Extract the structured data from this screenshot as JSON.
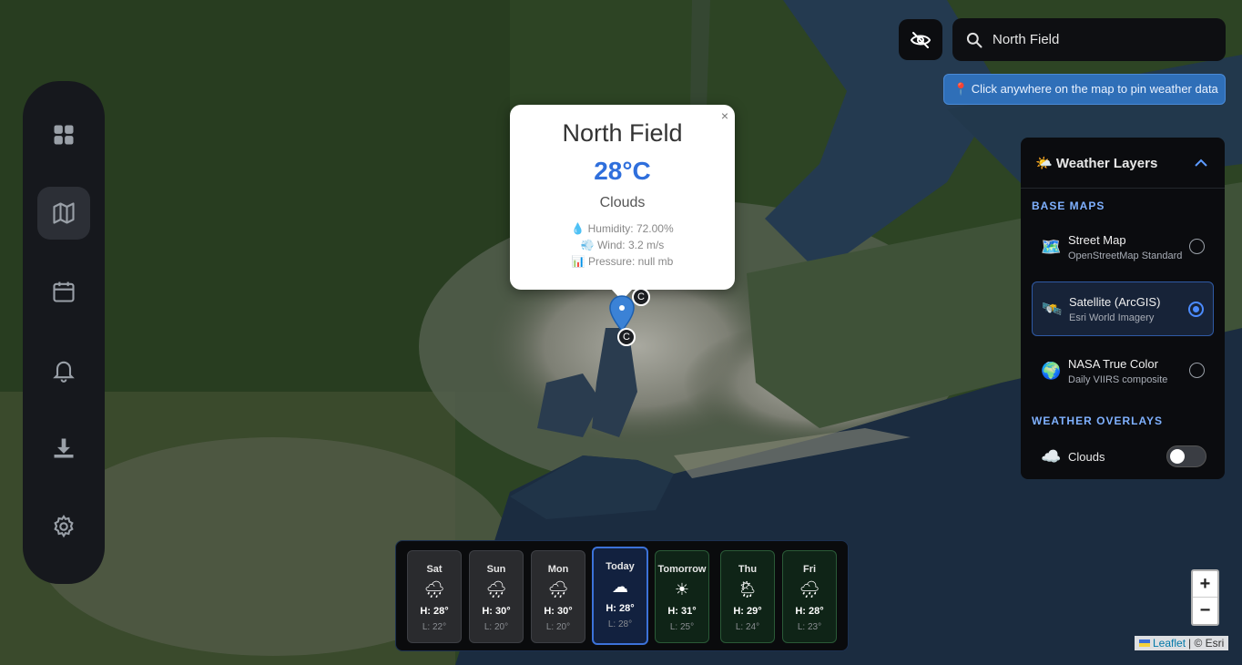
{
  "search": {
    "value": "North Field"
  },
  "hint": {
    "text": "📍 Click anywhere on the map to pin weather data"
  },
  "popup": {
    "close": "×",
    "city": "North Field",
    "temp": "28°C",
    "condition": "Clouds",
    "humidity": "💧 Humidity: 72.00%",
    "wind": "💨 Wind: 3.2 m/s",
    "pressure": "📊 Pressure: null mb"
  },
  "markers": {
    "cluster_label": "C"
  },
  "nav": {
    "icons": [
      "dashboard-icon",
      "map-icon",
      "calendar-icon",
      "bell-icon",
      "download-icon",
      "gear-icon"
    ],
    "active": "map-icon"
  },
  "layers": {
    "title": "🌤️ Weather Layers",
    "base_title": "BASE MAPS",
    "base_maps": [
      {
        "emoji": "🗺️",
        "name": "Street Map",
        "sub": "OpenStreetMap Standard",
        "selected": false
      },
      {
        "emoji": "🛰️",
        "name": "Satellite (ArcGIS)",
        "sub": "Esri World Imagery",
        "selected": true
      },
      {
        "emoji": "🌍",
        "name": "NASA True Color",
        "sub": "Daily VIIRS composite",
        "selected": false
      }
    ],
    "overlay_title": "WEATHER OVERLAYS",
    "overlays": [
      {
        "emoji": "☁️",
        "name": "Clouds",
        "on": false
      }
    ]
  },
  "forecast": [
    {
      "day": "Sat",
      "icon": "rain-icon",
      "hi": "H: 28°",
      "lo": "L: 22°",
      "kind": "past"
    },
    {
      "day": "Sun",
      "icon": "rain-icon",
      "hi": "H: 30°",
      "lo": "L: 20°",
      "kind": "past"
    },
    {
      "day": "Mon",
      "icon": "rain-icon",
      "hi": "H: 30°",
      "lo": "L: 20°",
      "kind": "past"
    },
    {
      "day": "Today",
      "icon": "cloud-icon",
      "hi": "H: 28°",
      "lo": "L: 28°",
      "kind": "today"
    },
    {
      "day": "Tomorrow",
      "icon": "sun-icon",
      "hi": "H: 31°",
      "lo": "L: 25°",
      "kind": "future"
    },
    {
      "day": "Thu",
      "icon": "sun-rain-icon",
      "hi": "H: 29°",
      "lo": "L: 24°",
      "kind": "future"
    },
    {
      "day": "Fri",
      "icon": "heavy-rain-icon",
      "hi": "H: 28°",
      "lo": "L: 23°",
      "kind": "future"
    }
  ],
  "zoom": {
    "in": "+",
    "out": "−"
  },
  "attribution": {
    "leaflet": "Leaflet",
    "rest": "| © Esri"
  },
  "colors": {
    "accent": "#2f6fdc",
    "panel": "#0b0c0f",
    "today_border": "#3c72d8"
  }
}
